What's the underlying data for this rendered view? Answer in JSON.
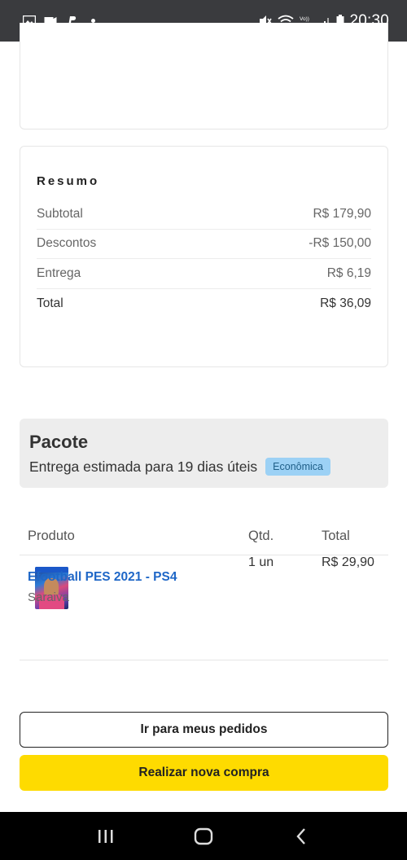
{
  "status_bar": {
    "time": "20:30",
    "left_icons": [
      "image-icon",
      "whatsapp-icon",
      "paypal-icon",
      "dot-icon"
    ],
    "right_icons": [
      "mute-icon",
      "wifi-icon",
      "volte-icon",
      "signal-icon",
      "battery-icon"
    ]
  },
  "resumo": {
    "title": "Resumo",
    "rows": [
      {
        "label": "Subtotal",
        "value": "R$ 179,90"
      },
      {
        "label": "Descontos",
        "value": "-R$ 150,00"
      },
      {
        "label": "Entrega",
        "value": "R$ 6,19"
      },
      {
        "label": "Total",
        "value": "R$ 36,09"
      }
    ]
  },
  "pacote": {
    "title": "Pacote",
    "delivery": "Entrega estimada para 19 dias úteis",
    "badge": "Econômica"
  },
  "table": {
    "headers": {
      "produto": "Produto",
      "qtd": "Qtd.",
      "total": "Total"
    },
    "items": [
      {
        "name": "Efootball PES 2021 - PS4",
        "seller": "Saraiva",
        "qty": "1 un",
        "total": "R$ 29,90"
      }
    ]
  },
  "buttons": {
    "orders": "Ir para meus pedidos",
    "new_purchase": "Realizar nova compra"
  },
  "colors": {
    "primary_button": "#fedb00",
    "link": "#1f67c7",
    "badge_bg": "#9cd1f5",
    "status_bar": "#3a3b3e"
  },
  "nav": [
    "recent-apps-icon",
    "home-icon",
    "back-icon"
  ]
}
